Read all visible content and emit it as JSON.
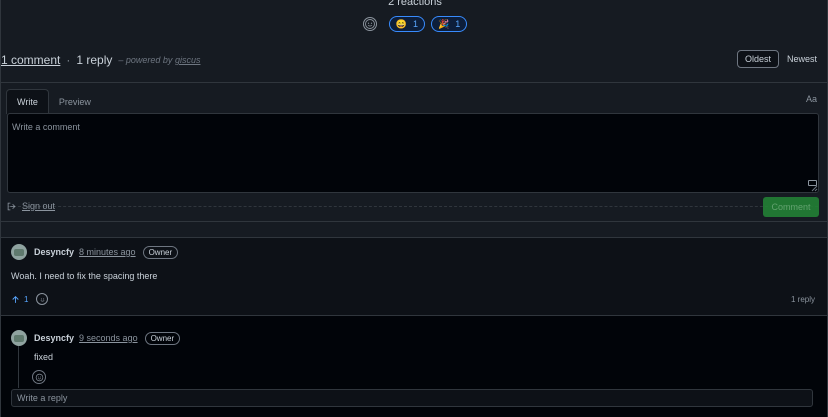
{
  "reactions": {
    "title": "2 reactions",
    "items": [
      {
        "emoji": "😄",
        "count": "1"
      },
      {
        "emoji": "🎉",
        "count": "1"
      }
    ]
  },
  "summary": {
    "comments": "1 comment",
    "separator": "·",
    "replies": "1 reply",
    "powered_prefix": "– powered by",
    "powered_name": "giscus"
  },
  "sort": {
    "oldest": "Oldest",
    "newest": "Newest",
    "active": "Oldest"
  },
  "editor": {
    "tab_write": "Write",
    "tab_preview": "Preview",
    "font_toggle": "Aa",
    "placeholder": "Write a comment",
    "sign_out": "Sign out",
    "submit": "Comment"
  },
  "comment": {
    "author": "Desyncfy",
    "time": "8 minutes ago",
    "badge": "Owner",
    "body": "Woah. I need to fix the spacing there",
    "upvotes": "1",
    "reply_count": "1 reply"
  },
  "reply": {
    "author": "Desyncfy",
    "time": "9 seconds ago",
    "badge": "Owner",
    "body": "fixed",
    "input_placeholder": "Write a reply"
  },
  "colors": {
    "accent": "#58a6ff",
    "submit": "#238636",
    "bg": "#161b22",
    "panel": "#0d1117"
  }
}
